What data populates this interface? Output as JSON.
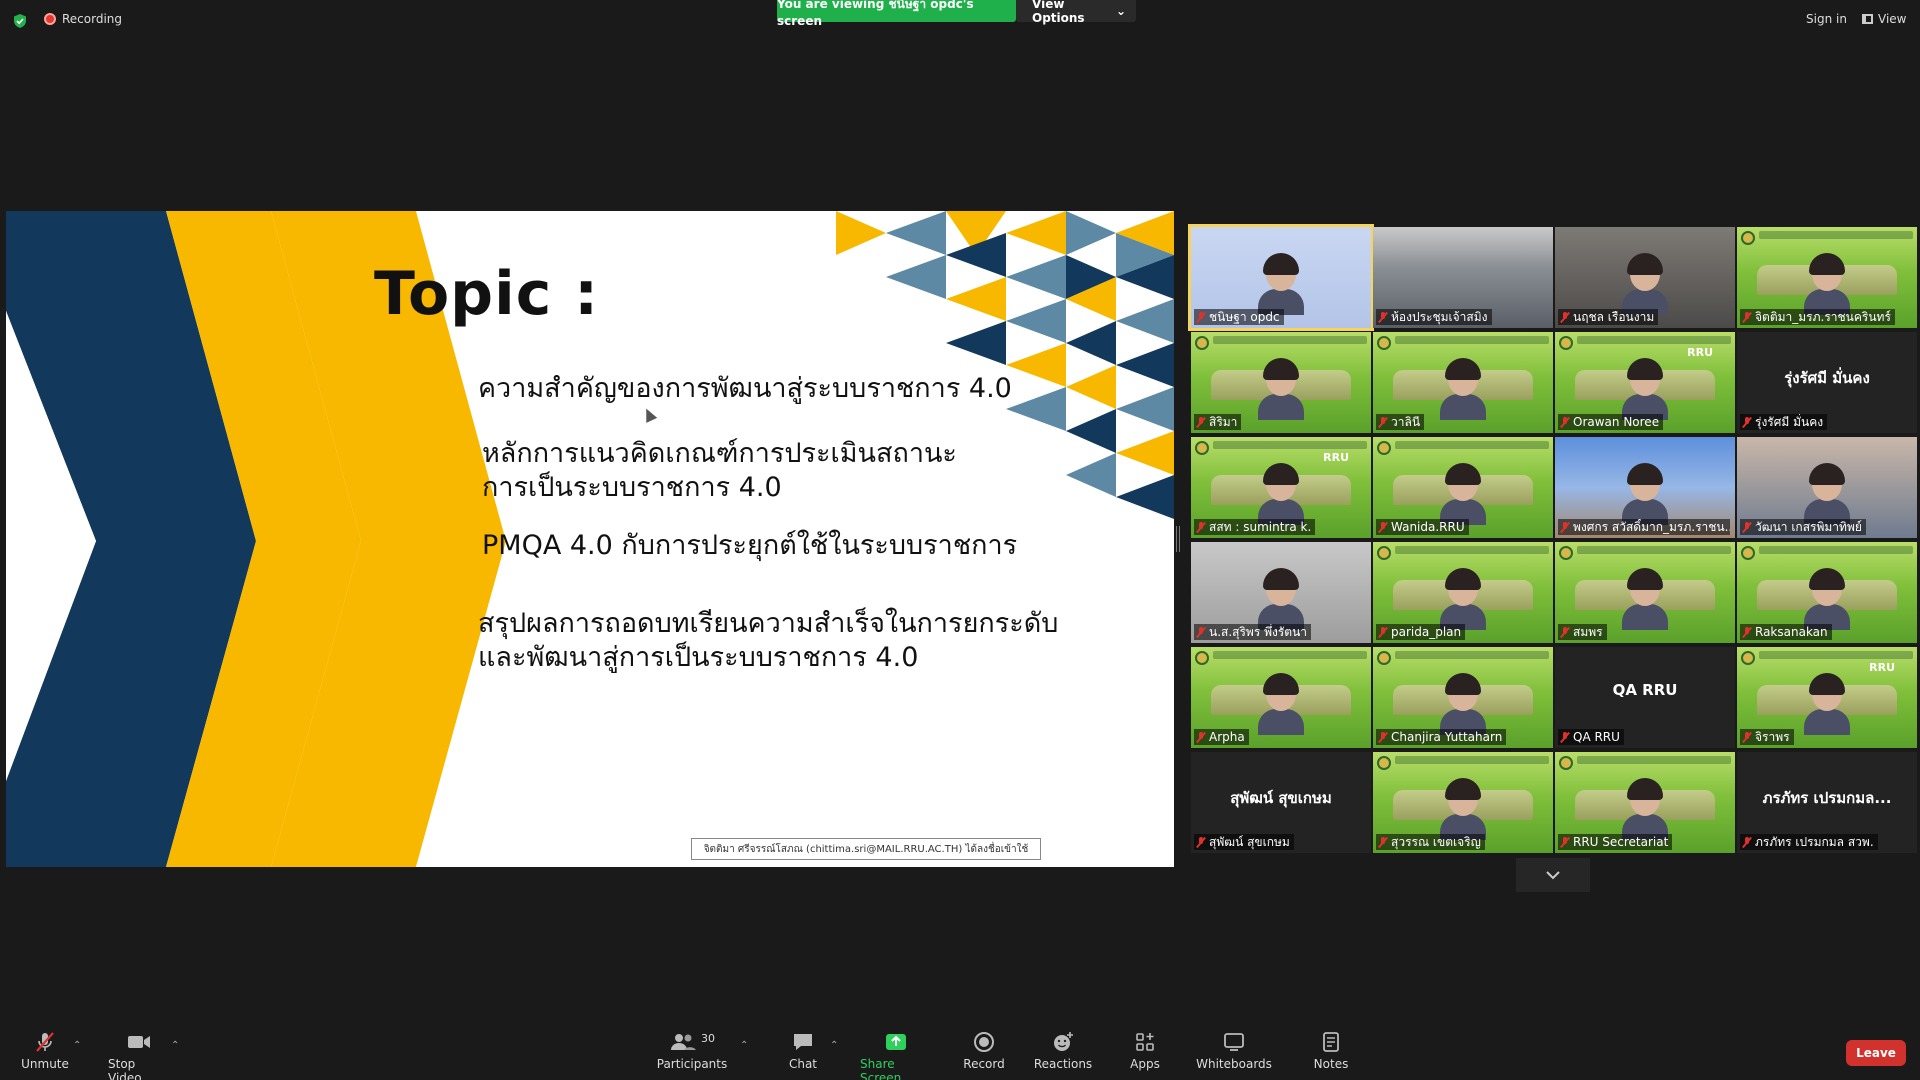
{
  "topbar": {
    "recording_label": "Recording",
    "viewing_banner": "You are viewing ชนิษฐา opdc's screen",
    "view_options_label": "View Options",
    "sign_in_label": "Sign in",
    "view_label": "View"
  },
  "slide": {
    "title": "Topic :",
    "line1": "ความสำคัญของการพัฒนาสู่ระบบราชการ 4.0",
    "line2a": "หลักการแนวคิดเกณฑ์การประเมินสถานะ",
    "line2b": "การเป็นระบบราชการ 4.0",
    "line3": "PMQA 4.0 กับการประยุกต์ใช้ในระบบราชการ",
    "line4a": "สรุปผลการถอดบทเรียนความสำเร็จในการยกระดับ",
    "line4b": "และพัฒนาสู่การเป็นระบบราชการ 4.0",
    "annotation_note": "จิตติมา ศรีจรรณ์โสภณ (chittima.sri@MAIL.RRU.AC.TH) ได้ลงชื่อเข้าใช้"
  },
  "participants": [
    {
      "name": "ชนิษฐา opdc",
      "bg": "blue"
    },
    {
      "name": "ห้องประชุมเจ้าสมิง",
      "bg": "room"
    },
    {
      "name": "นฤชล เรือนงาม",
      "bg": "office"
    },
    {
      "name": "จิตติมา_มรภ.ราชนครินทร์",
      "bg": "green"
    },
    {
      "name": "สิริมา",
      "bg": "green"
    },
    {
      "name": "วาลินี",
      "bg": "green"
    },
    {
      "name": "Orawan Noree",
      "bg": "green",
      "tag": "RRU"
    },
    {
      "name": "รุ่งรัศมี มั่นคง",
      "bg": "dark",
      "center": "รุ่งรัศมี  มั่นคง"
    },
    {
      "name": "สสท : sumintra k.",
      "bg": "green",
      "tag": "RRU"
    },
    {
      "name": "Wanida.RRU",
      "bg": "green"
    },
    {
      "name": "พงศกร สวัสดิ์มาก_มรภ.ราชน...",
      "bg": "sky"
    },
    {
      "name": "วัฒนา เกสรพิมาทิพย์",
      "bg": "blurcol"
    },
    {
      "name": "น.ส.สุริพร พึ่งรัตนา",
      "bg": "grey"
    },
    {
      "name": "parida_plan",
      "bg": "green"
    },
    {
      "name": "สมพร",
      "bg": "green"
    },
    {
      "name": "Raksanakan",
      "bg": "green"
    },
    {
      "name": "Arpha",
      "bg": "green"
    },
    {
      "name": "Chanjira Yuttaharn",
      "bg": "green"
    },
    {
      "name": "QA RRU",
      "bg": "dark",
      "center": "QA RRU"
    },
    {
      "name": "จิราพร",
      "bg": "green",
      "tag": "RRU"
    },
    {
      "name": "สุพัฒน์ สุขเกษม",
      "bg": "dark",
      "center": "สุพัฒน์ สุขเกษม"
    },
    {
      "name": "สุวรรณ เขตเจริญ",
      "bg": "green"
    },
    {
      "name": "RRU Secretariat",
      "bg": "green"
    },
    {
      "name": "ภรภัทร เปรมกมล สวพ.",
      "bg": "dark",
      "center": "ภรภัทร เปรมกมล..."
    }
  ],
  "toolbar": {
    "unmute": "Unmute",
    "stop_video": "Stop Video",
    "participants": "Participants",
    "participants_count": "30",
    "chat": "Chat",
    "share_screen": "Share Screen",
    "record": "Record",
    "reactions": "Reactions",
    "apps": "Apps",
    "whiteboards": "Whiteboards",
    "notes": "Notes",
    "leave": "Leave"
  },
  "colors": {
    "banner_green": "#20b04b",
    "slide_navy": "#12385b",
    "slide_yellow": "#f9b800",
    "slide_steel": "#5d89a5",
    "leave_red": "#d2322d"
  }
}
